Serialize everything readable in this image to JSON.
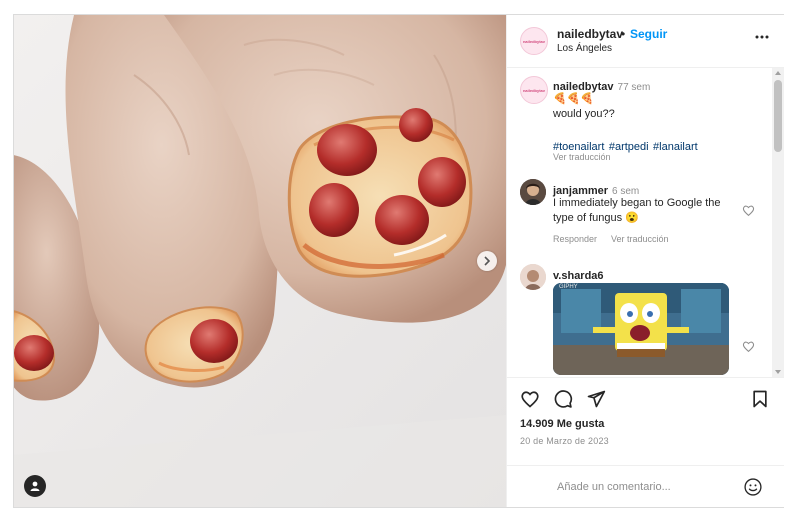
{
  "post": {
    "author": {
      "username": "nailedbytav",
      "avatar_text": "nailedbytav",
      "separator": "•",
      "follow_label": "Seguir",
      "location": "Los Ángeles"
    },
    "caption": {
      "username": "nailedbytav",
      "time": "77 sem",
      "emoji_line": "🍕🍕🍕",
      "text": "would you??",
      "hashtags": [
        "#toenailart",
        "#artpedi",
        "#lanailart"
      ],
      "see_translation": "Ver traducción"
    },
    "comments": [
      {
        "username": "janjammer",
        "time": "6 sem",
        "text_line1": "I immediately began to Google the",
        "text_line2": "type of fungus 😮",
        "reply_label": "Responder",
        "see_translation": "Ver traducción"
      },
      {
        "username": "v.sharda6",
        "gif_caption": "GIPHY"
      }
    ],
    "likes": "14.909 Me gusta",
    "date": "20 de Marzo de 2023",
    "add_comment_placeholder": "Añade un comentario..."
  },
  "icons": {
    "more": "more-horizontal-icon",
    "like": "heart-icon",
    "comment": "comment-icon",
    "share": "paper-plane-icon",
    "save": "bookmark-icon",
    "emoji": "smiley-icon",
    "next": "chevron-right-icon",
    "user_tag": "user-tag-icon"
  },
  "colors": {
    "link_blue": "#0095f6",
    "text": "#262626",
    "muted": "#8e8e8e",
    "hashtag": "#00376b"
  }
}
